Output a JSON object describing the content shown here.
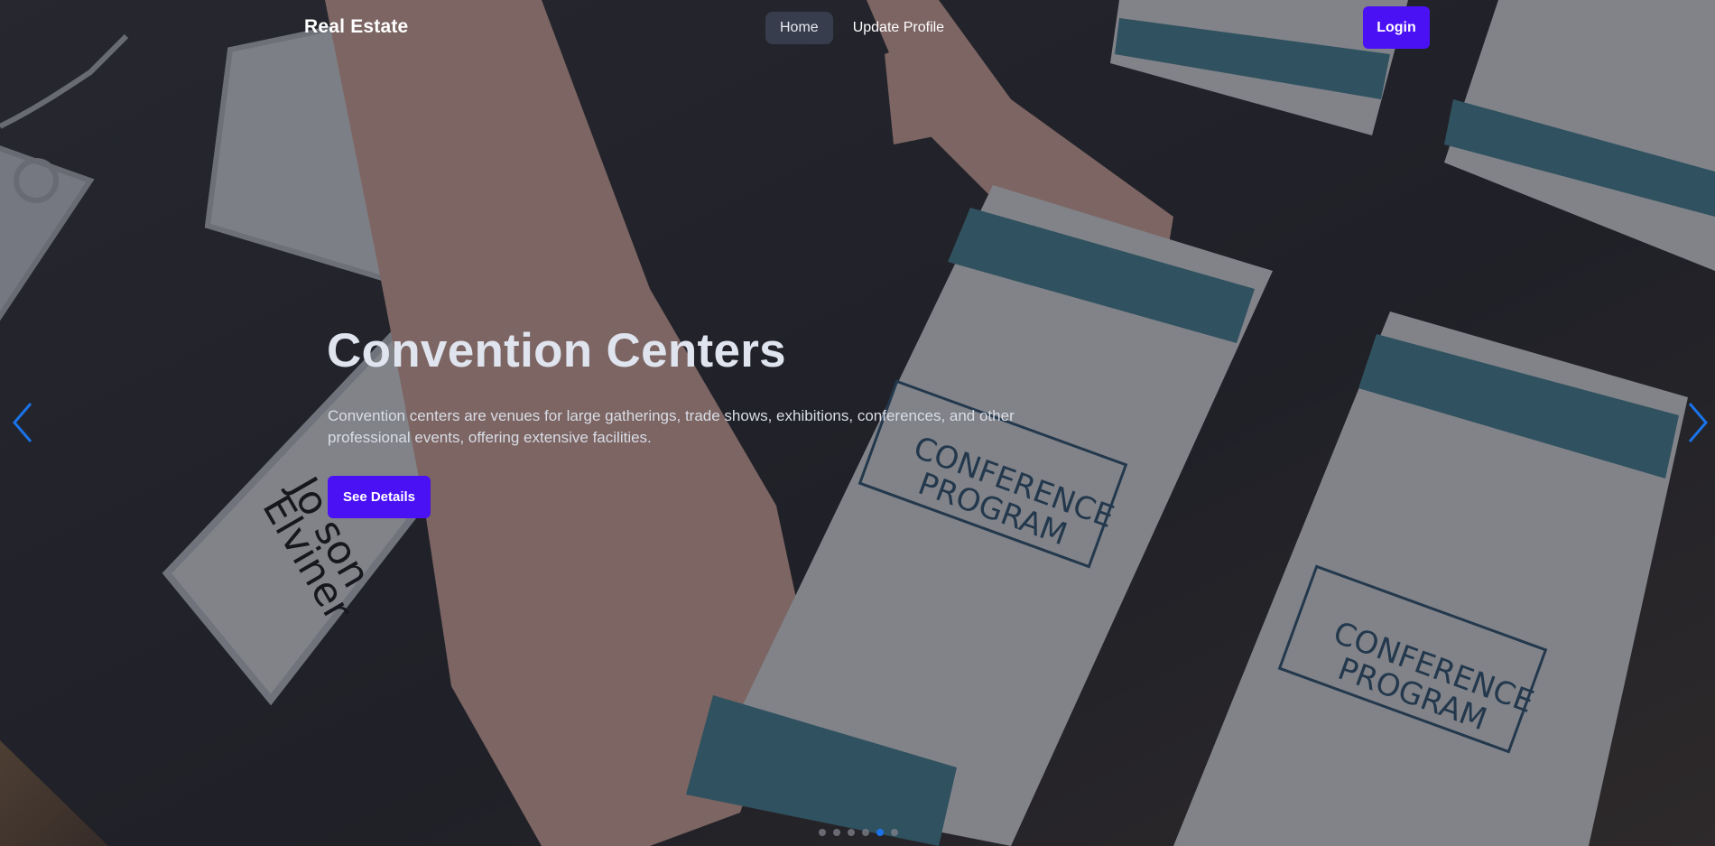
{
  "navbar": {
    "brand": "Real Estate",
    "links": [
      {
        "label": "Home",
        "active": true
      },
      {
        "label": "Update Profile",
        "active": false
      }
    ],
    "login_label": "Login"
  },
  "hero": {
    "title": "Convention Centers",
    "description": "Convention centers are venues for large gatherings, trade shows, exhibitions, conferences, and other professional events, offering extensive facilities.",
    "cta_label": "See Details"
  },
  "carousel": {
    "prev_icon": "chevron-left-icon",
    "next_icon": "chevron-right-icon",
    "slide_count": 6,
    "active_index": 4
  },
  "background": {
    "description_visible_text": [
      "CONFERENCE PROGRAM",
      "CONFERENCE PROGRAM",
      "Jo...son Elviner"
    ]
  },
  "colors": {
    "accent": "#4b11f5",
    "indicator_active": "#1a73e8",
    "arrow": "#1a73e8"
  }
}
